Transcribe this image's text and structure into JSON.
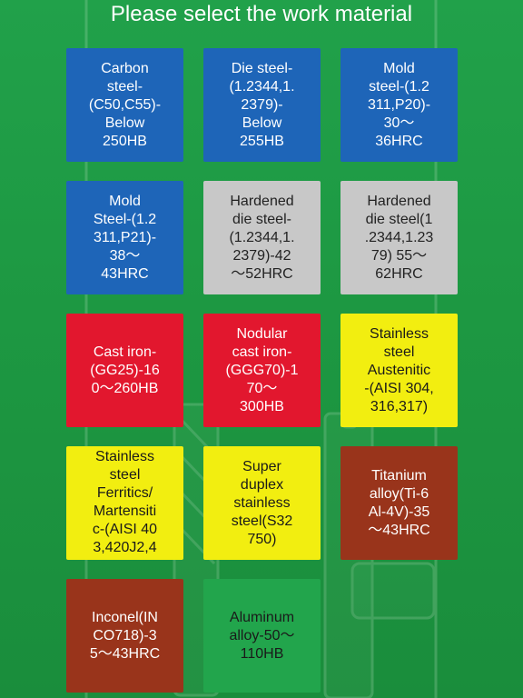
{
  "title": "Please select the work material",
  "colors": {
    "background": "#1f9a43",
    "blue": "#1e65b8",
    "gray": "#c8c8c8",
    "red": "#e2172e",
    "yellow": "#f2ee10",
    "brown": "#99341b",
    "green": "#22a54c"
  },
  "background_image": "faded-milling-tool-illustration",
  "materials": [
    {
      "label": "Carbon\nsteel-\n(C50,C55)-\nBelow\n250HB",
      "color": "blue"
    },
    {
      "label": "Die steel-\n(1.2344,1.\n2379)-\nBelow\n255HB",
      "color": "blue"
    },
    {
      "label": "Mold\nsteel-(1.2\n311,P20)-\n30～\n36HRC",
      "color": "blue"
    },
    {
      "label": "Mold\nSteel-(1.2\n311,P21)-\n38～\n43HRC",
      "color": "blue"
    },
    {
      "label": "Hardened\ndie steel-\n(1.2344,1.\n2379)-42\n～52HRC",
      "color": "gray"
    },
    {
      "label": "Hardened\ndie steel(1\n.2344,1.23\n79) 55～\n62HRC",
      "color": "gray"
    },
    {
      "label": "Cast iron-\n(GG25)-16\n0～260HB",
      "color": "red"
    },
    {
      "label": "Nodular\ncast iron-\n(GGG70)-1\n70～\n300HB",
      "color": "red"
    },
    {
      "label": "Stainless\nsteel\nAustenitic\n-(AISI 304,\n316,317)",
      "color": "yellow"
    },
    {
      "label": "Stainless\nsteel\nFerritics/\nMartensiti\nc-(AISI 40\n3,420J2,4",
      "color": "yellow",
      "cut": true
    },
    {
      "label": "Super\nduplex\nstainless\nsteel(S32\n750)",
      "color": "yellow"
    },
    {
      "label": "Titanium\nalloy(Ti-6\nAl-4V)-35\n～43HRC",
      "color": "brown"
    },
    {
      "label": "Inconel(IN\nCO718)-3\n5～43HRC",
      "color": "brown"
    },
    {
      "label": "Aluminum\nalloy-50～\n110HB",
      "color": "green"
    }
  ]
}
